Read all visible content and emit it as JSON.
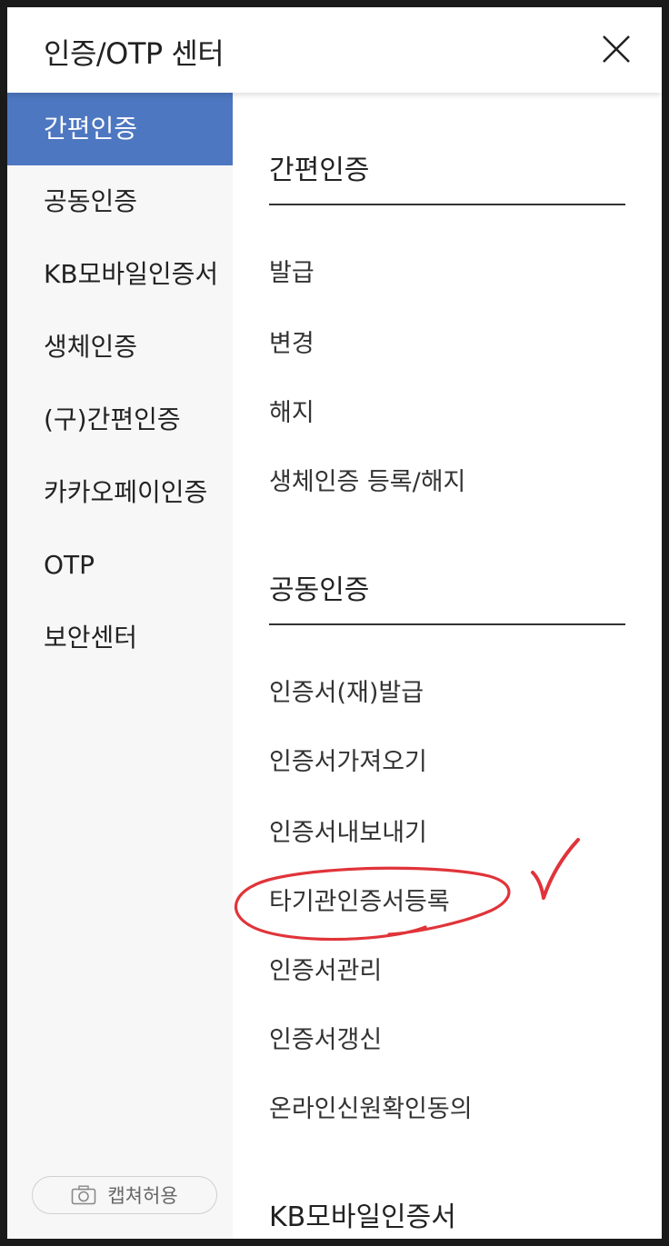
{
  "header": {
    "title": "인증/OTP 센터",
    "close_icon": "close-icon"
  },
  "sidebar": {
    "items": [
      {
        "label": "간편인증",
        "active": true
      },
      {
        "label": "공동인증",
        "active": false
      },
      {
        "label": "KB모바일인증서",
        "active": false
      },
      {
        "label": "생체인증",
        "active": false
      },
      {
        "label": "(구)간편인증",
        "active": false
      },
      {
        "label": "카카오페이인증",
        "active": false
      },
      {
        "label": "OTP",
        "active": false
      },
      {
        "label": "보안센터",
        "active": false
      }
    ],
    "capture_button": {
      "label": "캡쳐허용",
      "icon": "camera-icon"
    }
  },
  "content": {
    "sections": [
      {
        "title": "간편인증",
        "items": [
          "발급",
          "변경",
          "해지",
          "생체인증 등록/해지"
        ]
      },
      {
        "title": "공동인증",
        "items": [
          "인증서(재)발급",
          "인증서가져오기",
          "인증서내보내기",
          "타기관인증서등록",
          "인증서관리",
          "인증서갱신",
          "온라인신원확인동의"
        ]
      },
      {
        "title": "KB모바일인증서",
        "items": []
      }
    ]
  },
  "colors": {
    "accent": "#4d77c0",
    "sidebar_bg": "#f7f7f8",
    "annotation": "#e0343a"
  }
}
